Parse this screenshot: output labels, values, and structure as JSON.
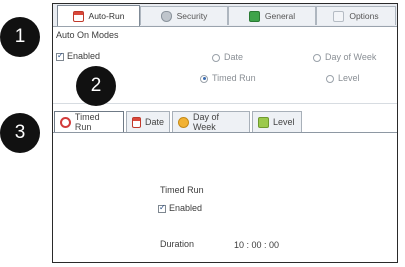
{
  "top_tabs": [
    {
      "label": "Auto-Run",
      "icon": "calendar-icon"
    },
    {
      "label": "Security",
      "icon": "shield-icon"
    },
    {
      "label": "General",
      "icon": "green-square-icon"
    },
    {
      "label": "Options",
      "icon": "page-icon"
    }
  ],
  "auto_on_modes": {
    "title": "Auto On Modes",
    "enabled_label": "Enabled",
    "radios": {
      "date": "Date",
      "day_of_week": "Day of Week",
      "timed_run": "Timed Run",
      "level": "Level"
    }
  },
  "sub_tabs": [
    {
      "label": "Timed Run",
      "icon": "clock-icon"
    },
    {
      "label": "Date",
      "icon": "calendar-icon"
    },
    {
      "label": "Day of Week",
      "icon": "day-of-week-icon"
    },
    {
      "label": "Level",
      "icon": "level-icon"
    }
  ],
  "timed_run": {
    "title": "Timed Run",
    "enabled_label": "Enabled",
    "duration_label": "Duration",
    "duration_value": "10 : 00 : 00"
  },
  "badges": [
    "1",
    "2",
    "3"
  ]
}
